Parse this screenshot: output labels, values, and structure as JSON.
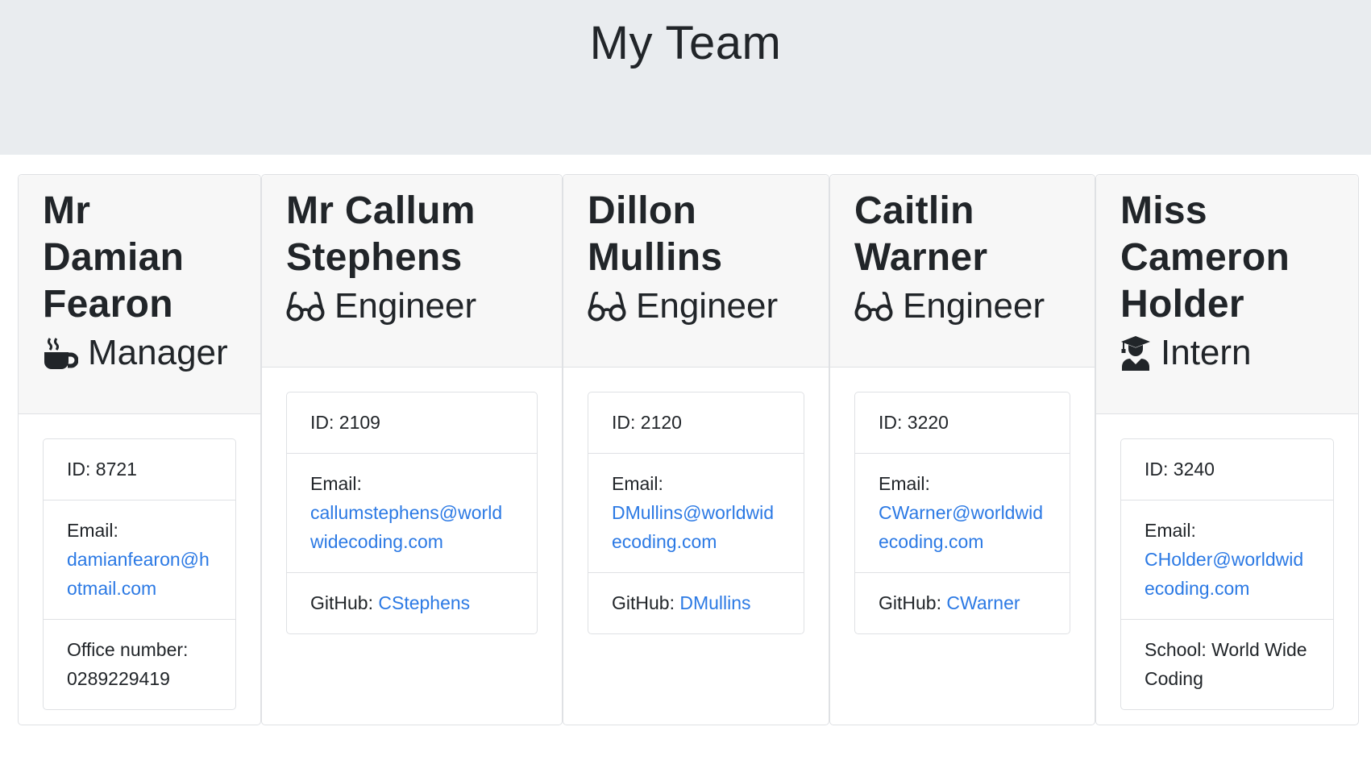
{
  "header": {
    "title": "My Team"
  },
  "team": [
    {
      "name": "Mr Damian Fearon",
      "role": "Manager",
      "role_icon": "coffee-mug-icon",
      "id_text": "ID: 8721",
      "email_label": "Email:",
      "email": "damianfearon@hotmail.com",
      "extra_label": "Office number:",
      "extra_value": "0289229419"
    },
    {
      "name": "Mr Callum Stephens",
      "role": "Engineer",
      "role_icon": "glasses-icon",
      "id_text": "ID: 2109",
      "email_label": "Email:",
      "email": "callumstephens@worldwidecoding.com",
      "extra_label": "GitHub:",
      "extra_value": "CStephens"
    },
    {
      "name": "Dillon Mullins",
      "role": "Engineer",
      "role_icon": "glasses-icon",
      "id_text": "ID: 2120",
      "email_label": "Email:",
      "email": "DMullins@worldwidecoding.com",
      "extra_label": "GitHub:",
      "extra_value": "DMullins"
    },
    {
      "name": "Caitlin Warner",
      "role": "Engineer",
      "role_icon": "glasses-icon",
      "id_text": "ID: 3220",
      "email_label": "Email:",
      "email": "CWarner@worldwidecoding.com",
      "extra_label": "GitHub:",
      "extra_value": "CWarner"
    },
    {
      "name": "Miss Cameron Holder",
      "role": "Intern",
      "role_icon": "graduate-icon",
      "id_text": "ID: 3240",
      "email_label": "Email:",
      "email": "CHolder@worldwidecoding.com",
      "extra_label": "School:",
      "extra_value": "World Wide Coding"
    }
  ],
  "colors": {
    "jumbotron": "#e9ecef",
    "link": "#2b79e4",
    "header_bg": "#f7f7f7"
  }
}
